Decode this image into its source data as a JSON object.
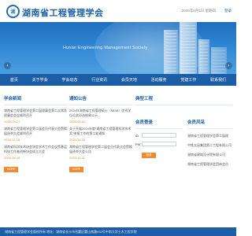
{
  "header": {
    "logo_text": "湖",
    "site_title": "湖南省工程管理学会",
    "date_text": "2025年5月1日 星期四",
    "login_link": "登录"
  },
  "banner": {
    "subtitle": "Hunan Engineering Management Society",
    "arrow_left": "‹",
    "arrow_right": "›"
  },
  "nav": {
    "items": [
      "首页",
      "关于学会",
      "学会动态",
      "行业资讯",
      "会员天地",
      "活动服务",
      "党建工作",
      "联系我们"
    ]
  },
  "news_column": {
    "title": "学会新闻",
    "articles": [
      {
        "title": "湖南省工程管理学会第二届理事会第二次常务理事会会议顺利召开",
        "date": "2025-04-27"
      },
      {
        "title": "湖南省工程管理学会第二届会员代表大会暨换届选举大会顺利召开",
        "date": "2024-11-16"
      },
      {
        "title": "湖南省科学技术协会学会学术工作会议暨基层科技工作者创新协会成立大会",
        "date": "2024-04-16"
      }
    ],
    "more_label": "MORE"
  },
  "notice_column": {
    "title": "通知公告",
    "articles": [
      {
        "title": "2024年湖南省工程管理硕士（MEM）优秀学位论文评选结果公示",
        "date": "2025-01-02"
      },
      {
        "title": "关于开展2024年度“湖南省工程管理科学技术奖”申报工作的第二轮通知",
        "date": "2024-11-16"
      },
      {
        "title": "湖南省工程管理学会第二届会员代表大会暨换届选举大会公告",
        "date": "2024-11-11"
      }
    ],
    "more_label": "MORE"
  },
  "right_panel": {
    "title": "典型工程",
    "login": {
      "title": "会员登录",
      "id_label": "ID",
      "pw_label": "PW",
      "button": "登录"
    },
    "services": {
      "title": "会员风采",
      "items": [
        "湖南省工程管理学会第二届理",
        "中铁五局集团第二工程有限公司",
        "湖南省建筑设计院有限公司",
        "湖南省工程管理学会团体会员"
      ]
    }
  },
  "footer": {
    "text": "湖南省工程管理学会版权所有    地址：湖南省长沙市岳麓区麓山南路932号中南大学土木工程学院"
  }
}
